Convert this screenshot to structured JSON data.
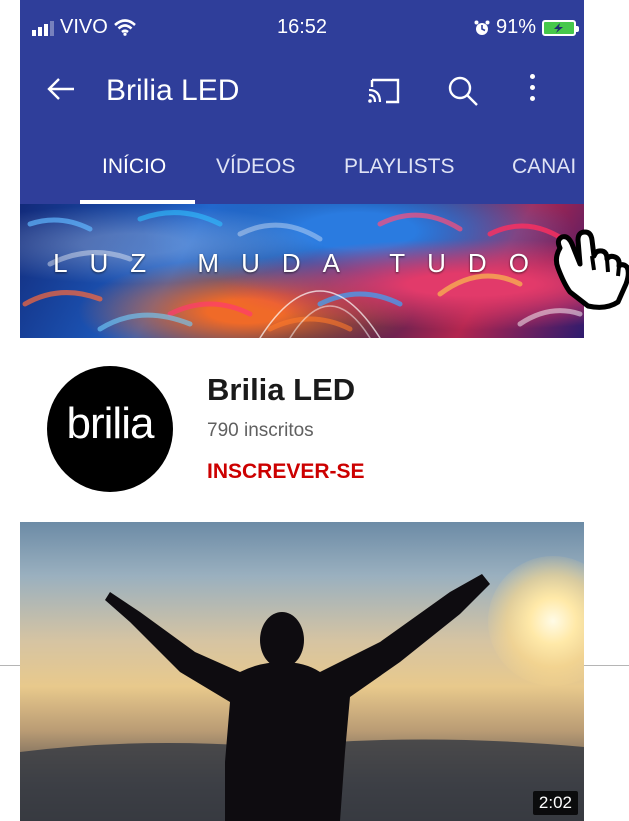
{
  "status_bar": {
    "carrier": "VIVO",
    "time": "16:52",
    "battery": "91%"
  },
  "app_bar": {
    "title": "Brilia LED",
    "icons": [
      "back-arrow-icon",
      "cast-icon",
      "search-icon",
      "more-vert-icon"
    ]
  },
  "tabs": [
    {
      "label": "INÍCIO",
      "active": true
    },
    {
      "label": "VÍDEOS",
      "active": false
    },
    {
      "label": "PLAYLISTS",
      "active": false
    },
    {
      "label": "CANAI",
      "active": false
    }
  ],
  "banner": {
    "text": "LUZ MUDA TUDO"
  },
  "channel": {
    "avatar_text": "brilia",
    "name": "Brilia LED",
    "subscribers": "790 inscritos",
    "subscribe_label": "INSCREVER-SE"
  },
  "video": {
    "duration": "2:02"
  },
  "colors": {
    "app_bar": "#2f3e9a",
    "subscribe": "#cc0000",
    "battery": "#46c84a"
  }
}
